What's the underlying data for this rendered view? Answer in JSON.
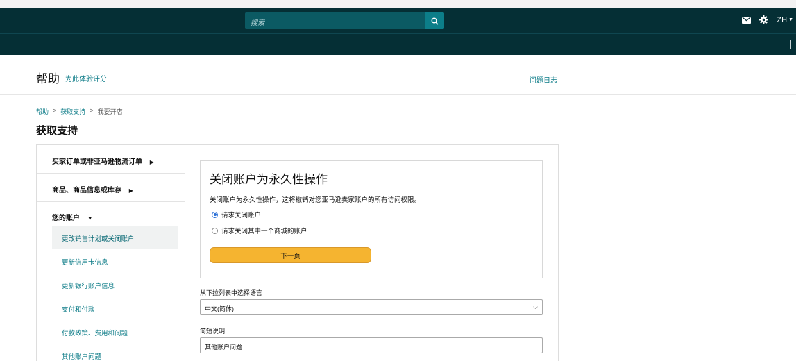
{
  "topbar": {
    "search_placeholder": "搜索",
    "lang": "ZH"
  },
  "helpbar": {
    "title": "帮助",
    "rate_link": "为此体验评分",
    "log_link": "问题日志"
  },
  "breadcrumb": {
    "items": [
      "帮助",
      "获取支持",
      "我要开店"
    ],
    "sep": ">"
  },
  "page": {
    "title": "获取支持"
  },
  "sidebar": {
    "sections": [
      {
        "label": "买家订单或非亚马逊物流订单",
        "arrow": "▶"
      },
      {
        "label": "商品、商品信息或库存",
        "arrow": "▶"
      }
    ],
    "account": {
      "label": "您的账户",
      "arrow": "▼"
    },
    "items": [
      {
        "label": "更改销售计划或关闭账户"
      },
      {
        "label": "更新信用卡信息"
      },
      {
        "label": "更新银行账户信息"
      },
      {
        "label": "支付和付款"
      },
      {
        "label": "付款政策、费用和问题"
      },
      {
        "label": "其他账户问题"
      }
    ]
  },
  "card": {
    "title": "关闭账户为永久性操作",
    "description": "关闭账户为永久性操作，这将撤销对您亚马逊卖家账户的所有访问权限。",
    "options": [
      {
        "label": "请求关闭账户",
        "selected": true
      },
      {
        "label": "请求关闭其中一个商城的账户",
        "selected": false
      }
    ],
    "next_button": "下一页"
  },
  "form": {
    "language_label": "从下拉列表中选择语言",
    "language_value": "中文(简体)",
    "summary_label": "简短说明",
    "summary_value": "其他账户问题"
  },
  "colors": {
    "topbar": "#052f35",
    "accent": "#0a7a86",
    "button": "#f5b430"
  }
}
